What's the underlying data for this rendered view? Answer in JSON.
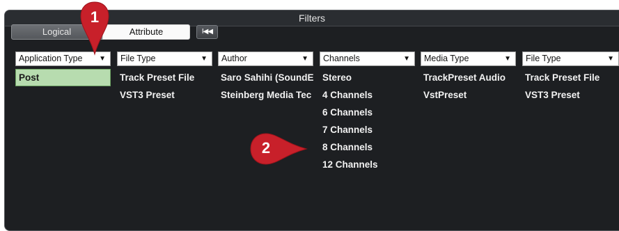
{
  "panel": {
    "title": "Filters"
  },
  "toolbar": {
    "logical_label": "Logical",
    "attribute_label": "Attribute",
    "reset_glyph": "I◀◀"
  },
  "columns": [
    {
      "header": "Application Type",
      "items": [
        "Post"
      ],
      "selected": 0
    },
    {
      "header": "File Type",
      "items": [
        "Track Preset File",
        "VST3 Preset"
      ]
    },
    {
      "header": "Author",
      "items": [
        "Saro Sahihi (SoundE",
        "Steinberg Media Tec"
      ]
    },
    {
      "header": "Channels",
      "items": [
        "Stereo",
        "4 Channels",
        "6 Channels",
        "7 Channels",
        "8 Channels",
        "12 Channels"
      ]
    },
    {
      "header": "Media Type",
      "items": [
        "TrackPreset Audio",
        "VstPreset"
      ]
    },
    {
      "header": "File Type",
      "items": [
        "Track Preset File",
        "VST3 Preset"
      ]
    }
  ],
  "callouts": [
    "1",
    "2"
  ],
  "colors": {
    "callout": "#c8202a",
    "selected_row": "#b7dcaf",
    "panel_bg": "#1d1f22"
  }
}
